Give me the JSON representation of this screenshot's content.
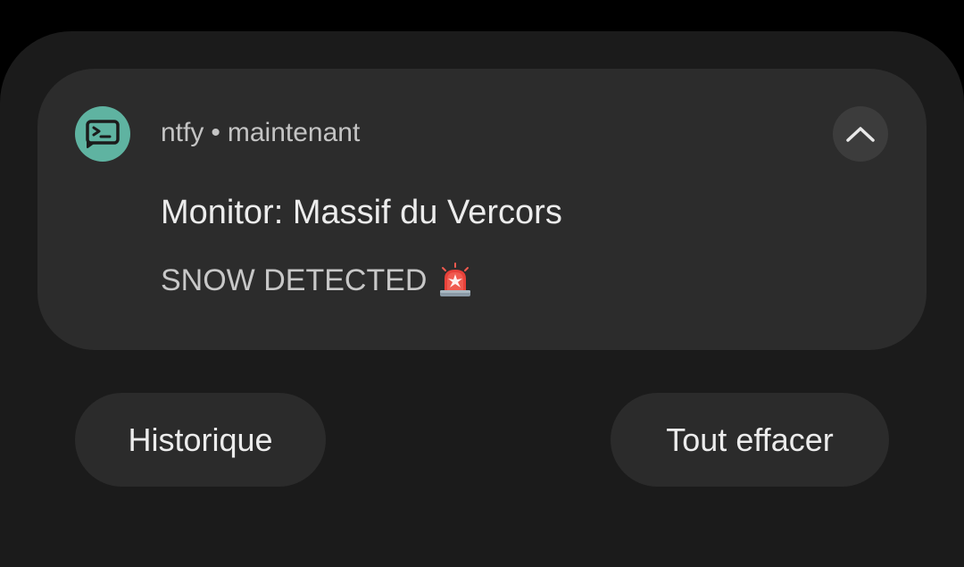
{
  "notification": {
    "app_name": "ntfy",
    "separator": "•",
    "time": "maintenant",
    "title": "Monitor: Massif du Vercors",
    "message": "SNOW DETECTED",
    "message_emoji_icon": "police-car-light-icon",
    "app_icon": "terminal-icon",
    "app_icon_color": "#5fb3a1",
    "expand_icon": "chevron-up-icon"
  },
  "actions": {
    "history_label": "Historique",
    "clear_all_label": "Tout effacer"
  },
  "colors": {
    "background": "#000000",
    "shade": "#1b1b1b",
    "card": "#2c2c2c",
    "button": "#2b2b2b"
  }
}
